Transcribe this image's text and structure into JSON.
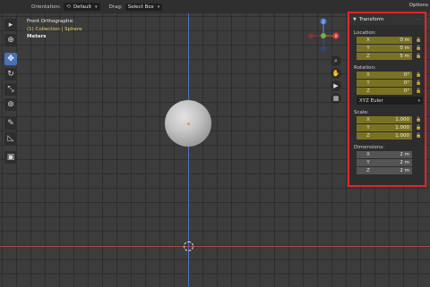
{
  "header": {
    "orientation_label": "Orientation:",
    "orientation_value": "Default",
    "drag_label": "Drag:",
    "drag_value": "Select Box",
    "options_label": "Options"
  },
  "viewport_info": {
    "view_name": "Front Orthographic",
    "collection": "(1) Collection | Sphere",
    "units": "Meters"
  },
  "gizmo": {
    "z_label": "Z",
    "x_label": "X"
  },
  "toolbar": {
    "tools": [
      {
        "icon": "select-cursor-icon",
        "glyph": "▸",
        "active": false
      },
      {
        "icon": "cursor-icon",
        "glyph": "⊕",
        "active": false
      },
      {
        "icon": "move-icon",
        "glyph": "✥",
        "active": true
      },
      {
        "icon": "rotate-icon",
        "glyph": "↻",
        "active": false
      },
      {
        "icon": "scale-icon",
        "glyph": "⤡",
        "active": false
      },
      {
        "icon": "transform-icon",
        "glyph": "⊛",
        "active": false
      },
      {
        "icon": "annotate-icon",
        "glyph": "✎",
        "active": false
      },
      {
        "icon": "measure-icon",
        "glyph": "◺",
        "active": false
      },
      {
        "icon": "add-cube-icon",
        "glyph": "▣",
        "active": false
      }
    ]
  },
  "transform": {
    "title": "Transform",
    "location_label": "Location:",
    "location": [
      {
        "axis": "X",
        "value": "0 m"
      },
      {
        "axis": "Y",
        "value": "0 m"
      },
      {
        "axis": "Z",
        "value": "5 m"
      }
    ],
    "rotation_label": "Rotation:",
    "rotation": [
      {
        "axis": "X",
        "value": "0°"
      },
      {
        "axis": "Y",
        "value": "0°"
      },
      {
        "axis": "Z",
        "value": "0°"
      }
    ],
    "rotation_mode": "XYZ Euler",
    "scale_label": "Scale:",
    "scale": [
      {
        "axis": "X",
        "value": "1.000"
      },
      {
        "axis": "Y",
        "value": "1.000"
      },
      {
        "axis": "Z",
        "value": "1.000"
      }
    ],
    "dimensions_label": "Dimensions:",
    "dimensions": [
      {
        "axis": "X",
        "value": "2 m"
      },
      {
        "axis": "Y",
        "value": "2 m"
      },
      {
        "axis": "Z",
        "value": "2 m"
      }
    ]
  },
  "colors": {
    "highlight_border": "#e0252c",
    "active_tool": "#4772b3",
    "field_olive": "#7a7223",
    "axis_x": "#b84a4a",
    "axis_z": "#4a73c4"
  }
}
